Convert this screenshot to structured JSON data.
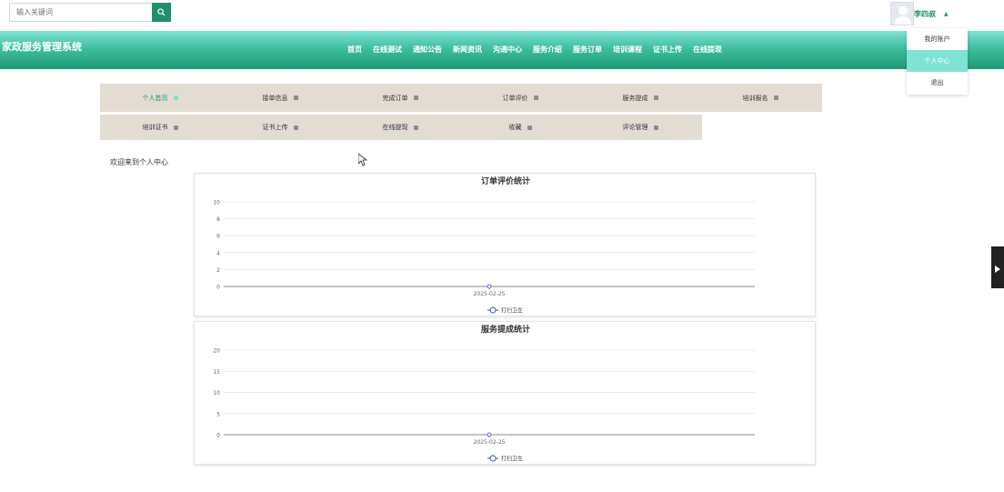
{
  "search": {
    "placeholder": "输入关键词"
  },
  "user": {
    "name": "李四叔"
  },
  "dropdown": {
    "items": [
      {
        "label": "我的账户"
      },
      {
        "label": "个人中心"
      },
      {
        "label": "退出"
      }
    ]
  },
  "header": {
    "site_title": "家政服务管理系统",
    "nav": [
      {
        "label": "首页"
      },
      {
        "label": "在线测试"
      },
      {
        "label": "通知公告"
      },
      {
        "label": "新闻资讯"
      },
      {
        "label": "沟通中心"
      },
      {
        "label": "服务介绍"
      },
      {
        "label": "服务订单"
      },
      {
        "label": "培训课程"
      },
      {
        "label": "证书上传"
      },
      {
        "label": "在线提现"
      }
    ]
  },
  "menu": {
    "row1": [
      {
        "label": "个人首页"
      },
      {
        "label": "接单信息"
      },
      {
        "label": "完成订单"
      },
      {
        "label": "订单评价"
      },
      {
        "label": "服务提成"
      },
      {
        "label": "培训报名"
      }
    ],
    "row2": [
      {
        "label": "培训证书"
      },
      {
        "label": "证书上传"
      },
      {
        "label": "在线提现"
      },
      {
        "label": "收藏"
      },
      {
        "label": "评论管理"
      }
    ]
  },
  "welcome": "欢迎来到个人中心",
  "colors": {
    "accent": "#1f8f6d",
    "header_light": "#7fe3d3",
    "menu_bg": "#e3dcd2",
    "series": "#5470c6"
  },
  "chart_data": [
    {
      "type": "line",
      "title": "订单评价统计",
      "categories": [
        "2025-02-25"
      ],
      "series": [
        {
          "name": "打扫卫生",
          "values": [
            0
          ]
        }
      ],
      "ylim": [
        0,
        10
      ],
      "yticks": [
        0,
        2,
        4,
        6,
        8,
        10
      ],
      "grid": true,
      "legend": "bottom-center"
    },
    {
      "type": "line",
      "title": "服务提成统计",
      "categories": [
        "2025-02-25"
      ],
      "series": [
        {
          "name": "打扫卫生",
          "values": [
            0
          ]
        }
      ],
      "ylim": [
        0,
        20
      ],
      "yticks": [
        0,
        5,
        10,
        15,
        20
      ],
      "grid": true,
      "legend": "bottom-center"
    }
  ]
}
